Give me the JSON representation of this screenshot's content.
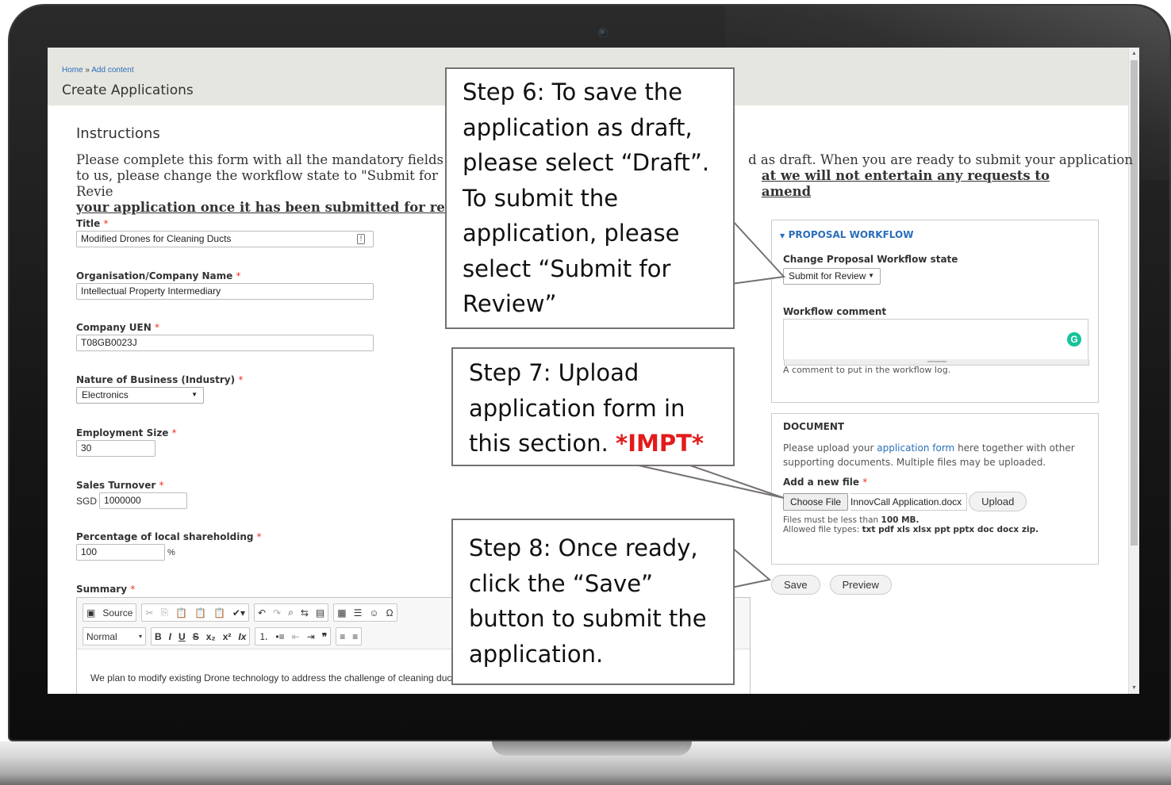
{
  "breadcrumb": {
    "home": "Home",
    "separator": "»",
    "current": "Add content"
  },
  "page_title": "Create Applications",
  "instructions": {
    "heading": "Instructions",
    "text_1": "Please complete this form with all the mandatory fields fille",
    "text_1b": "d as draft. When you are ready to submit your application",
    "text_2": "to us, please change the workflow state to \"Submit for Revie",
    "text_2b": "at we will not entertain any requests to amend",
    "text_3": "your application once it has been submitted for review."
  },
  "form": {
    "title": {
      "label": "Title",
      "value": "Modified Drones for Cleaning Ducts"
    },
    "organisation": {
      "label": "Organisation/Company Name",
      "value": "Intellectual Property Intermediary"
    },
    "uen": {
      "label": "Company UEN",
      "value": "T08GB0023J"
    },
    "industry": {
      "label": "Nature of Business (Industry)",
      "value": "Electronics"
    },
    "employment": {
      "label": "Employment Size",
      "value": "30"
    },
    "turnover": {
      "label": "Sales Turnover",
      "prefix": "SGD",
      "value": "1000000"
    },
    "shareholding": {
      "label": "Percentage of local shareholding",
      "value": "100",
      "suffix": "%"
    },
    "summary": {
      "label": "Summary",
      "text": "We plan to modify existing Drone technology to address the challenge of cleaning ducts."
    },
    "required_marker": "*"
  },
  "editor_toolbar": {
    "source_label": "Source",
    "format_label": "Normal"
  },
  "workflow": {
    "section_title": "PROPOSAL WORKFLOW",
    "state_label": "Change Proposal Workflow state",
    "state_value": "Submit for Review",
    "comment_label": "Workflow comment",
    "comment_help": "A comment to put in the workflow log."
  },
  "document": {
    "section_title": "DOCUMENT",
    "help_pre": "Please upload your ",
    "help_link": "application form",
    "help_post": " here together with other",
    "help_line2": "supporting documents. Multiple files may be uploaded.",
    "add_label": "Add a new file",
    "choose_label": "Choose File",
    "file_name": "InnovCall Application.docx",
    "upload_label": "Upload",
    "limit_pre": "Files must be less than ",
    "limit_value": "100 MB.",
    "types_pre": "Allowed file types: ",
    "types_value": "txt pdf xls xlsx ppt pptx doc docx zip."
  },
  "actions": {
    "save_label": "Save",
    "preview_label": "Preview"
  },
  "callouts": {
    "step6": [
      "Step 6: To save  the",
      "application as draft,",
      "please select “Draft”.",
      "To submit the",
      "application, please",
      "select “Submit for",
      "Review”"
    ],
    "step7_l1": "Step 7: Upload",
    "step7_l2": "application form in",
    "step7_l3": "this section. ",
    "step7_impt": "*IMPT*",
    "step8": [
      "Step 8: Once ready,",
      "click the “Save”",
      "button to submit the",
      "application."
    ]
  }
}
